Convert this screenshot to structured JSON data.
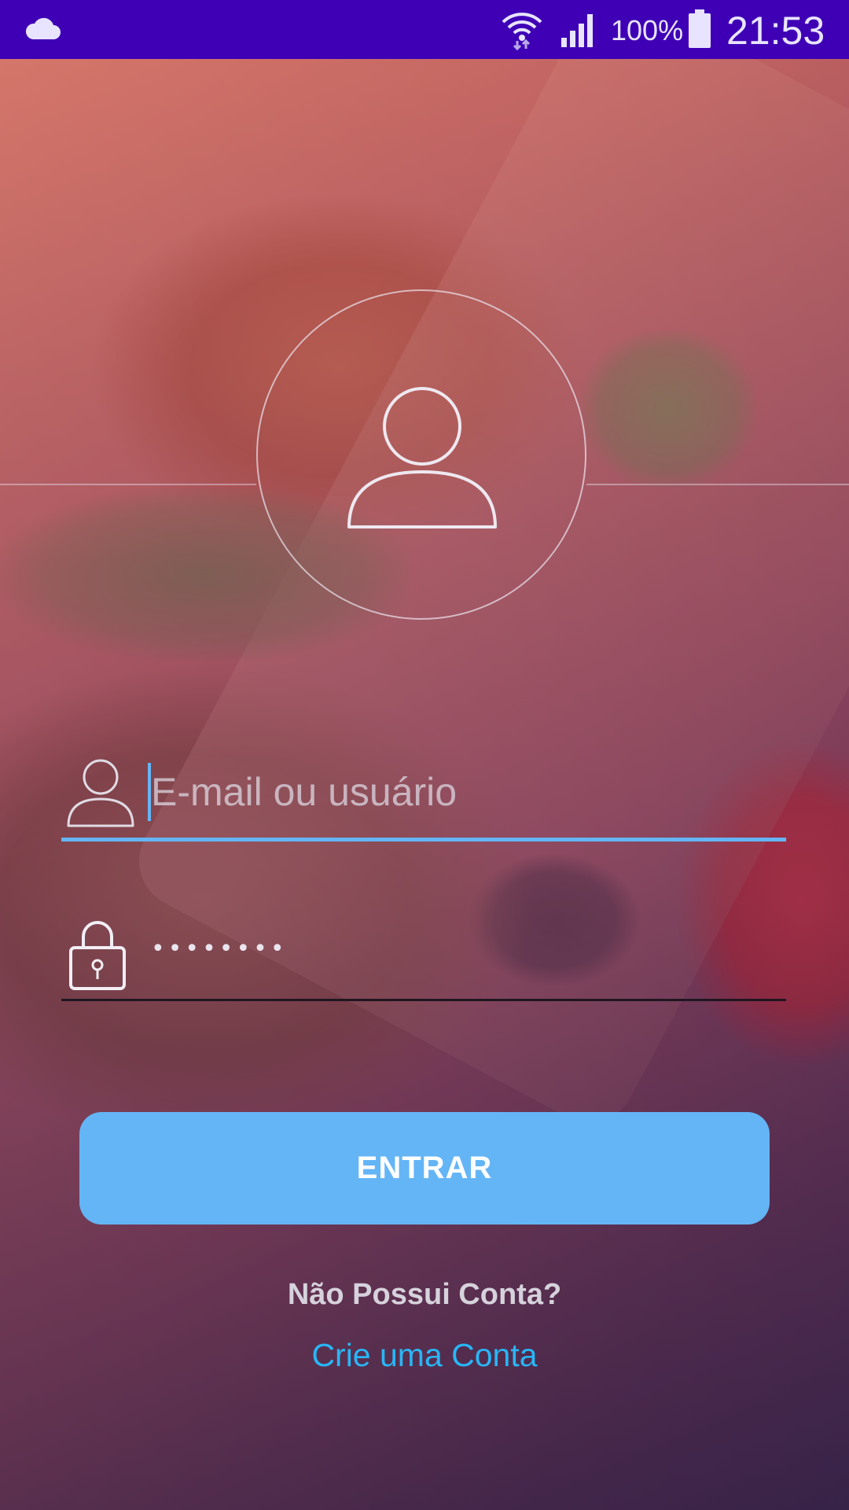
{
  "status_bar": {
    "battery": "100%",
    "time": "21:53",
    "icons": [
      "cloud-icon",
      "wifi-icon",
      "signal-icon",
      "battery-icon"
    ]
  },
  "login": {
    "avatar_icon": "person-icon",
    "email": {
      "placeholder": "E-mail ou usuário",
      "value": "",
      "icon": "person-icon"
    },
    "password": {
      "value": "••••••••",
      "icon": "lock-icon"
    },
    "submit_label": "ENTRAR",
    "no_account_text": "Não Possui Conta?",
    "create_account_link": "Crie uma Conta"
  },
  "colors": {
    "status_bar": "#3f00b5",
    "accent": "#64b5f6",
    "link": "#29b6f6"
  }
}
